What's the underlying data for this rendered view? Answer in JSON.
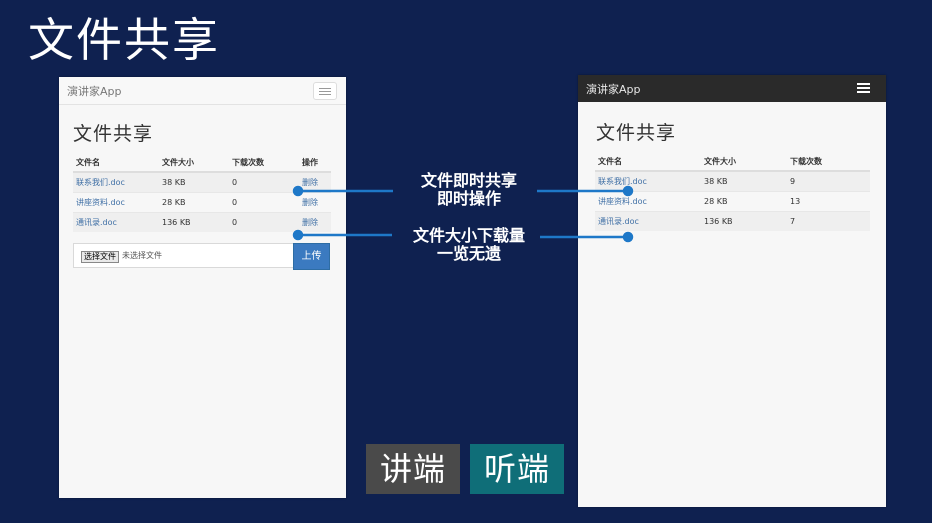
{
  "slide": {
    "title": "文件共享",
    "callouts": [
      {
        "line1": "文件即时共享",
        "line2": "即时操作"
      },
      {
        "line1": "文件大小下载量",
        "line2": "一览无遗"
      }
    ],
    "tags": {
      "speaker": "讲端",
      "listener": "听端"
    }
  },
  "left_app": {
    "brand": "演讲家App",
    "page_title": "文件共享",
    "columns": [
      "文件名",
      "文件大小",
      "下载次数",
      "操作"
    ],
    "rows": [
      {
        "name": "联系我们.doc",
        "size": "38 KB",
        "downloads": "0",
        "action": "删除"
      },
      {
        "name": "讲座资料.doc",
        "size": "28 KB",
        "downloads": "0",
        "action": "删除"
      },
      {
        "name": "通讯录.doc",
        "size": "136 KB",
        "downloads": "0",
        "action": "删除"
      }
    ],
    "upload": {
      "choose_label": "选择文件",
      "no_file_text": "未选择文件",
      "button_label": "上传"
    }
  },
  "right_app": {
    "brand": "演讲家App",
    "page_title": "文件共享",
    "columns": [
      "文件名",
      "文件大小",
      "下载次数"
    ],
    "rows": [
      {
        "name": "联系我们.doc",
        "size": "38 KB",
        "downloads": "9"
      },
      {
        "name": "讲座资料.doc",
        "size": "28 KB",
        "downloads": "13"
      },
      {
        "name": "通讯录.doc",
        "size": "136 KB",
        "downloads": "7"
      }
    ]
  },
  "colors": {
    "background": "#0f2150",
    "link": "#3f6fa5",
    "connector": "#1e78c8",
    "upload_button": "#3b7ac0",
    "speaker_tag": "#4a4a4a",
    "listener_tag": "#0f6e78"
  }
}
